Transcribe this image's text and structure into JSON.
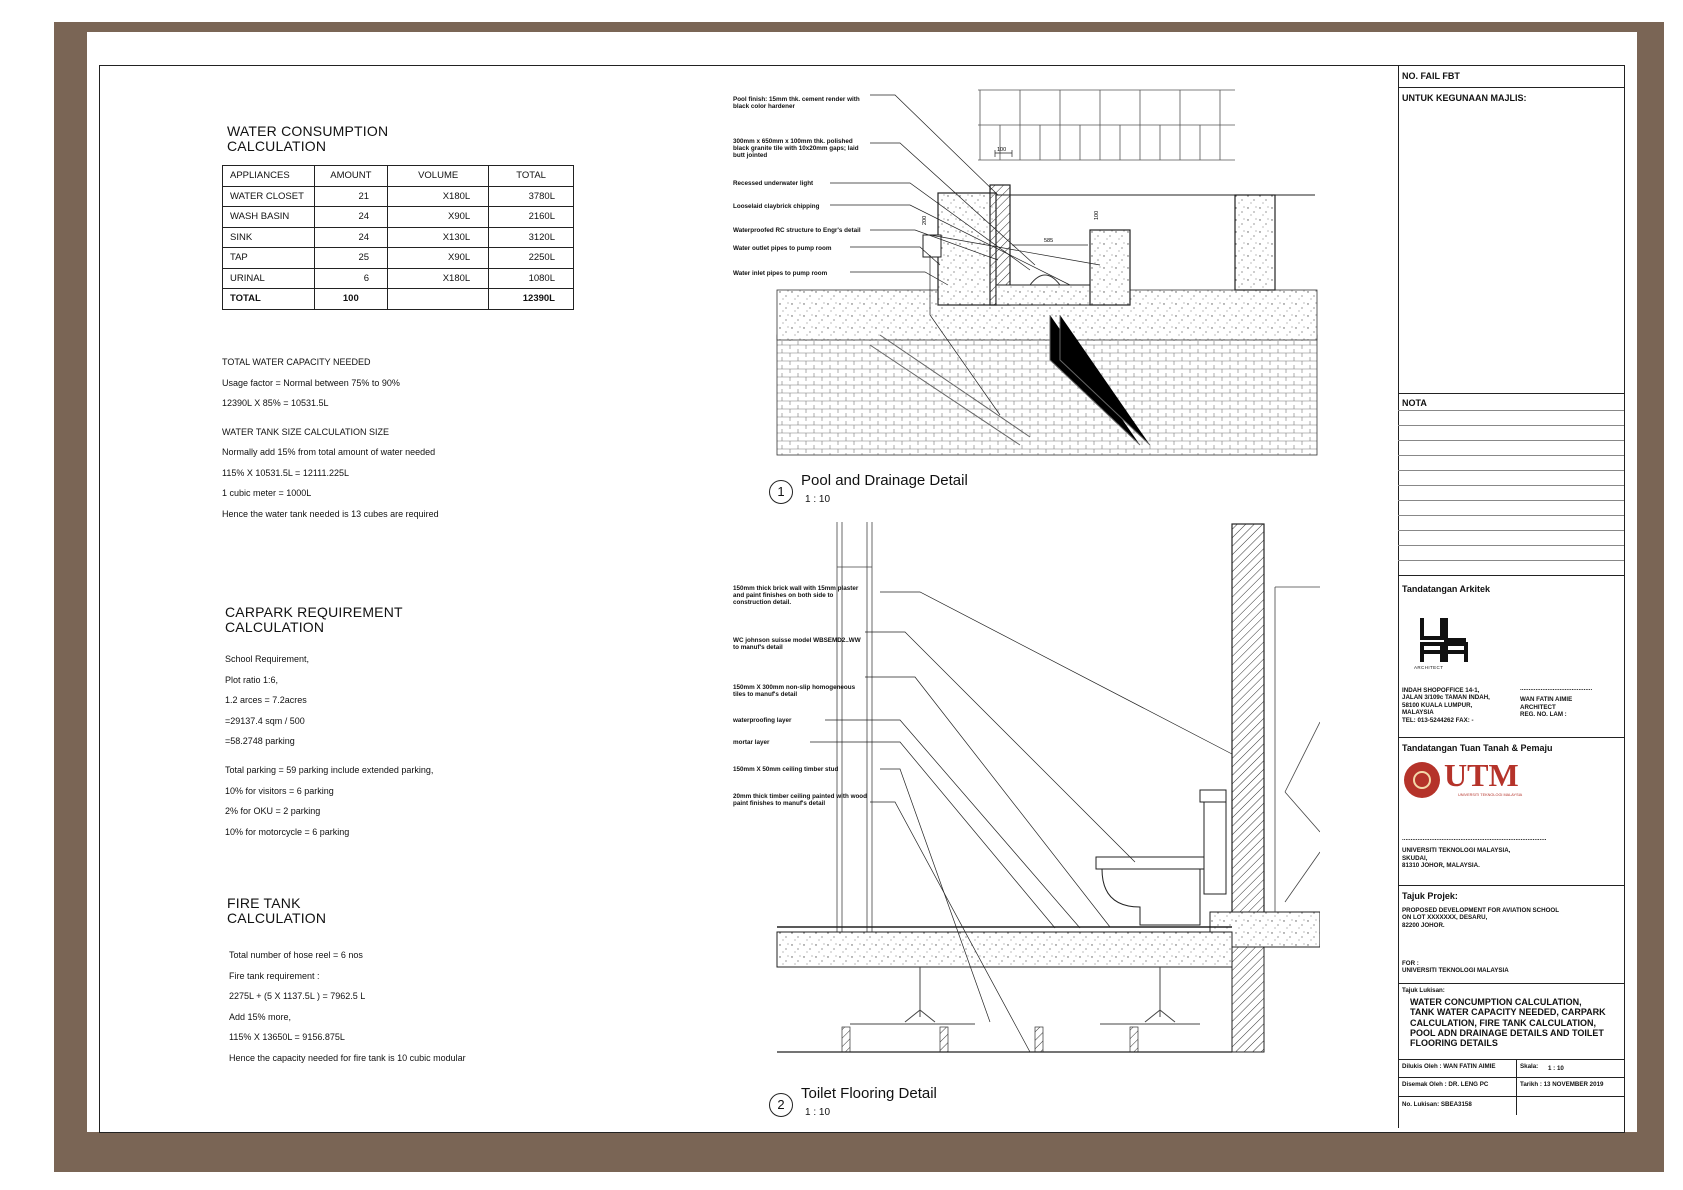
{
  "water": {
    "title_1": "WATER CONSUMPTION",
    "title_2": "CALCULATION",
    "headers": [
      "APPLIANCES",
      "AMOUNT",
      "VOLUME",
      "TOTAL"
    ],
    "rows": [
      [
        "WATER CLOSET",
        "21",
        "X180L",
        "3780L"
      ],
      [
        "WASH BASIN",
        "24",
        "X90L",
        "2160L"
      ],
      [
        "SINK",
        "24",
        "X130L",
        "3120L"
      ],
      [
        "TAP",
        "25",
        "X90L",
        "2250L"
      ],
      [
        "URINAL",
        "6",
        "X180L",
        "1080L"
      ]
    ],
    "total_row": [
      "TOTAL",
      "100",
      "",
      "12390L"
    ]
  },
  "capacity_lines": [
    "TOTAL WATER CAPACITY NEEDED",
    "Usage factor = Normal between 75% to 90%",
    "12390L X 85% = 10531.5L",
    "WATER TANK SIZE CALCULATION SIZE",
    "Normally add 15% from total amount of water needed",
    "115% X 10531.5L = 12111.225L",
    "1 cubic meter = 1000L",
    "Hence the water tank needed is 13 cubes are required"
  ],
  "carpark": {
    "title_1": "CARPARK REQUIREMENT",
    "title_2": "CALCULATION",
    "lines": [
      "School Requirement,",
      "Plot ratio 1:6,",
      "1.2 arces = 7.2acres",
      "=29137.4 sqm / 500",
      "=58.2748 parking",
      "Total parking = 59 parking include extended parking,",
      "10% for visitors = 6 parking",
      "2% for OKU = 2 parking",
      "10% for motorcycle = 6 parking"
    ]
  },
  "fire": {
    "title_1": "FIRE TANK",
    "title_2": "CALCULATION",
    "lines": [
      "Total number of hose reel = 6 nos",
      "Fire tank requirement :",
      "2275L + (5 X 1137.5L ) = 7962.5 L",
      "Add 15% more,",
      "115% X 13650L = 9156.875L",
      "Hence the capacity needed for fire tank is 10 cubic modular"
    ]
  },
  "detail1": {
    "number": "1",
    "title": "Pool and Drainage Detail",
    "scale": "1 : 10",
    "callouts": [
      "Pool finish: 15mm thk. cement render with black color hardener",
      "300mm x 650mm x 100mm thk. polished black granite tile with 10x20mm gaps; laid butt jointed",
      "Recessed underwater light",
      "Looselaid claybrick chipping",
      "Waterproofed RC structure to Engr's detail",
      "Water outlet pipes to pump room",
      "Water inlet pipes to pump room"
    ],
    "dims": [
      "100",
      "100",
      "200",
      "585"
    ]
  },
  "detail2": {
    "number": "2",
    "title": "Toilet Flooring Detail",
    "scale": "1 : 10",
    "callouts": [
      "150mm thick brick wall with 15mm plaster and paint finishes on both side to construction detail.",
      "WC johnson suisse model WBSEMD2..WW to manuf's detail",
      "150mm X 300mm non-slip homogeneous tiles to manuf's detail",
      "waterproofing layer",
      "mortar layer",
      "150mm X 50mm ceiling timber stud",
      "20mm thick timber ceiling painted with wood paint finishes to manuf's detail"
    ]
  },
  "title_block": {
    "no_fail": "NO. FAIL FBT",
    "untuk": "UNTUK KEGUNAAN MAJLIS:",
    "nota": "NOTA",
    "tandatangan_arkitek": "Tandatangan  Arkitek",
    "logo_caption": "ARCHITECT",
    "arch_address": [
      "INDAH SHOPOFFICE 14-1,",
      "JALAN 3/109c TAMAN INDAH,",
      "58100 KUALA LUMPUR,",
      "MALAYSIA",
      "TEL: 013-5244262    FAX: -"
    ],
    "arch_dots": "..........................................",
    "arch_name": [
      "WAN FATIN AIMIE",
      "ARCHITECT",
      "REG. NO. LAM :"
    ],
    "tandatangan_pemaju": "Tandatangan Tuan Tanah & Pemaju",
    "utm_logo": "UTM",
    "utm_sub": "UNIVERSITI TEKNOLOGI MALAYSIA",
    "owner_dots": "....................................................................................",
    "owner_address": [
      "UNIVERSITI TEKNOLOGI MALAYSIA,",
      "SKUDAI,",
      "81310 JOHOR, MALAYSIA."
    ],
    "tajuk_projek": "Tajuk Projek:",
    "project": [
      "PROPOSED DEVELOPMENT FOR AVIATION SCHOOL",
      "ON LOT XXXXXXX, DESARU,",
      "82200 JOHOR."
    ],
    "for_label": "FOR :",
    "for_value": "UNIVERSITI TEKNOLOGI MALAYSIA",
    "tajuk_lukisan": "Tajuk Lukisan:",
    "drawing_title": [
      "WATER CONCUMPTION CALCULATION,",
      "TANK WATER CAPACITY NEEDED, CARPARK",
      "CALCULATION, FIRE TANK CALCULATION,",
      "POOL ADN DRAINAGE DETAILS AND TOILET",
      "FLOORING DETAILS"
    ],
    "dilukis": "Dilukis Oleh : WAN FATIN AIMIE",
    "skala_label": "Skala:",
    "skala_value": "1 : 10",
    "disemak": "Disemak Oleh : DR. LENG PC",
    "tarikh": "Tarikh : 13 NOVEMBER 2019",
    "no_lukisan": "No. Lukisan: SBEA3158"
  },
  "colors": {
    "frame": "#7a6555",
    "utm_red": "#b5332a",
    "line": "#222222"
  }
}
